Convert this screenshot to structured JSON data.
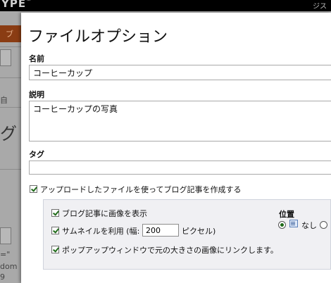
{
  "background": {
    "brand": "YPE",
    "brand_mark": "™",
    "user_text": "ジス",
    "tab_label": "ブ",
    "side_text_1": "自",
    "big_char": "グ",
    "frag_1": "=\"",
    "frag_2": "dom",
    "frag_3": "9"
  },
  "dialog": {
    "title": "ファイルオプション",
    "name": {
      "label": "名前",
      "value": "コーヒーカップ"
    },
    "description": {
      "label": "説明",
      "value": "コーヒーカップの写真"
    },
    "tags": {
      "label": "タグ",
      "value": ""
    },
    "create_post": {
      "label": "アップロードしたファイルを使ってブログ記事を作成する",
      "checked": true
    },
    "options": {
      "show_image": {
        "label": "ブログ記事に画像を表示",
        "checked": true
      },
      "thumbnail": {
        "label": "サムネイルを利用 (幅:",
        "width_value": "200",
        "unit_label": "ピクセル)",
        "checked": true
      },
      "popup_link": {
        "label": "ポップアップウィンドウで元の大きさの画像にリンクします。",
        "checked": true
      }
    },
    "position": {
      "label": "位置",
      "none_label": "なし",
      "selected": "none",
      "icon": "align-none-icon"
    }
  },
  "colors": {
    "checkmark": "#1f6b1a",
    "subpanel_bg": "#f0f0f3",
    "overlay_bg": "#a9a9a9"
  }
}
